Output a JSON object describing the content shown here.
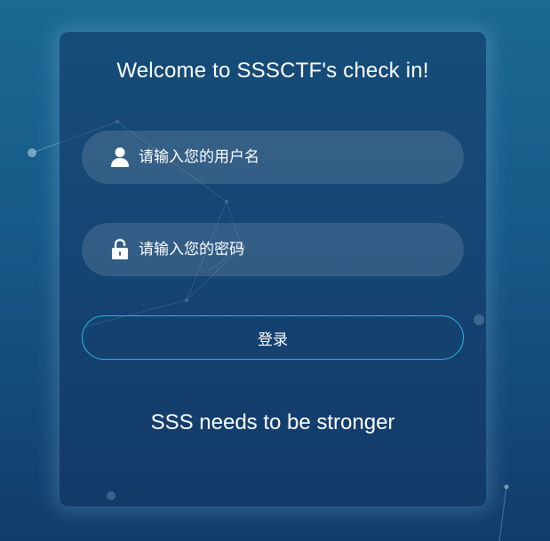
{
  "page": {
    "title": "Welcome to SSSCTF's check in!",
    "tagline": "SSS needs to be stronger"
  },
  "form": {
    "username": {
      "placeholder": "请输入您的用户名",
      "value": "",
      "icon": "user-icon"
    },
    "password": {
      "placeholder": "请输入您的密码",
      "value": "",
      "icon": "unlock-icon"
    },
    "submit_label": "登录"
  },
  "colors": {
    "background_top": "#1b6a93",
    "background_bottom": "#113c6a",
    "button_border": "#27b6e8",
    "text": "#ffffff"
  }
}
